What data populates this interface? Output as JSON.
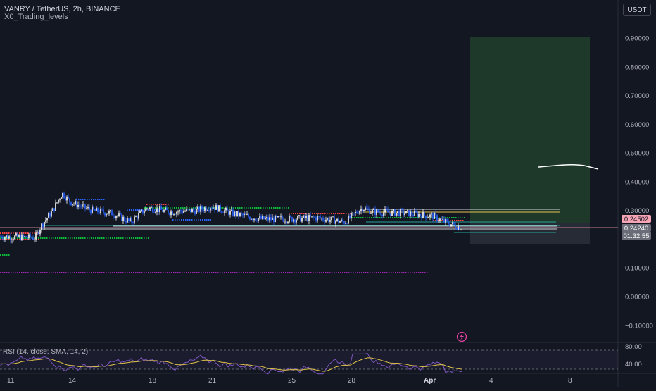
{
  "header": {
    "symbol_line": "VANRY / TetherUS, 2h, BINANCE",
    "indicator_name": "X0_Trading_levels",
    "currency_button": "USDT"
  },
  "price_axis": {
    "ticks": [
      "0.90000",
      "0.80000",
      "0.70000",
      "0.60000",
      "0.50000",
      "0.40000",
      "0.30000",
      "0.10000",
      "0.00000",
      "−0.10000"
    ],
    "tick_values": [
      0.9,
      0.8,
      0.7,
      0.6,
      0.5,
      0.4,
      0.3,
      0.1,
      0.0,
      -0.1
    ],
    "labels": {
      "price_tag_top": "0.24502",
      "price_tag_last": "0.24240",
      "countdown": "01:32:55"
    }
  },
  "rsi": {
    "title": "RSI (14, close, SMA, 14, 2)",
    "ticks": [
      "80.00",
      "40.00"
    ]
  },
  "time_axis": {
    "labels": [
      "11",
      "14",
      "18",
      "21",
      "25",
      "28",
      "Apr",
      "4",
      "8"
    ]
  },
  "colors": {
    "background": "#131722",
    "candle_up": "#ffffff",
    "candle_down": "#2962ff",
    "level_green": "#0bbf3a",
    "level_red": "#ff4040",
    "level_blue": "#2962ff",
    "level_magenta": "#9c27b0",
    "target_box": "#1f3a2b",
    "rsi_line": "#7e57c2",
    "rsi_sma": "#e0c34a",
    "price_tag": "#f7a4b4"
  },
  "icons": {
    "flash": "lightning-icon"
  }
}
